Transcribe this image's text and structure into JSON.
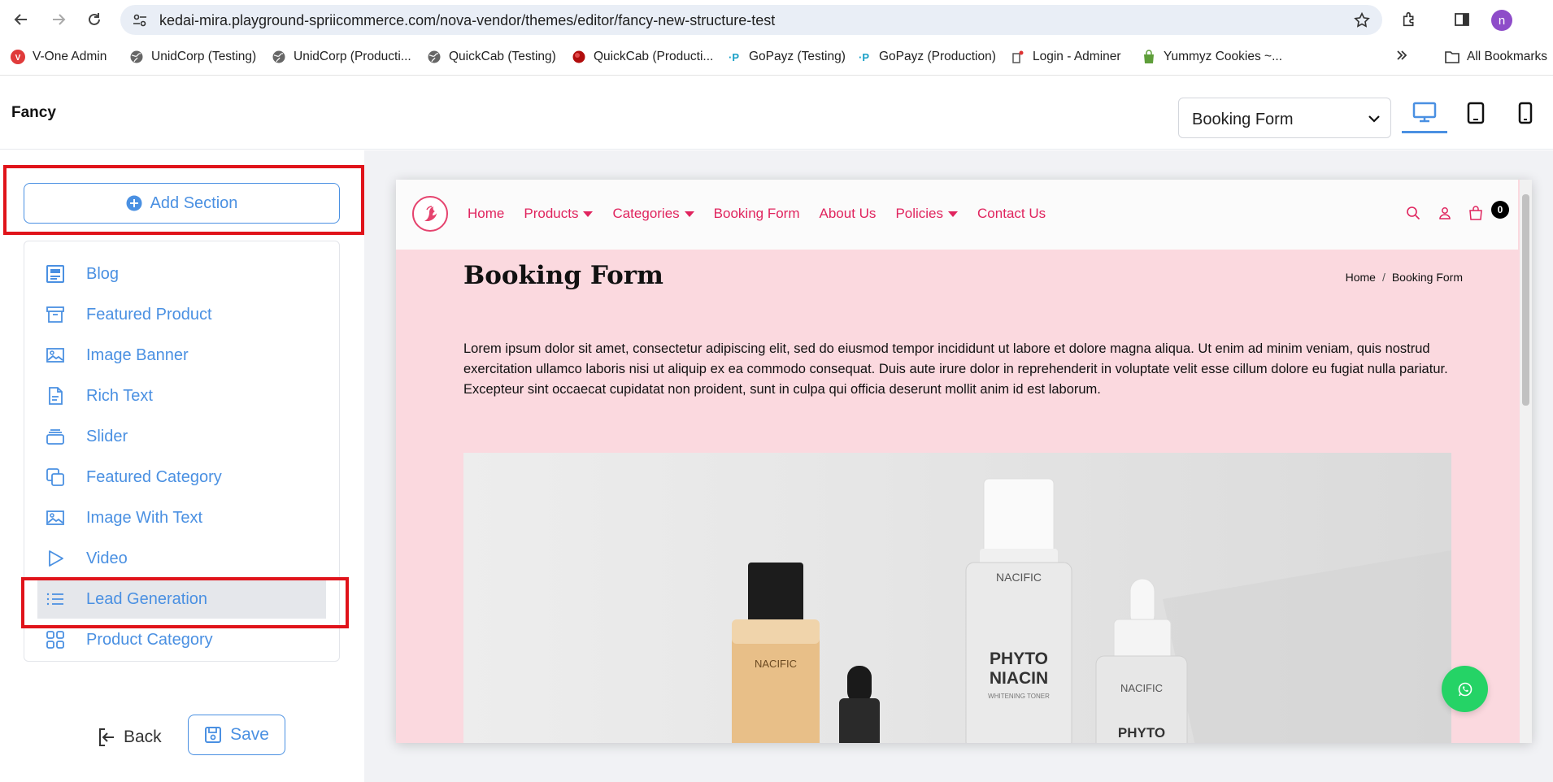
{
  "browser": {
    "url": "kedai-mira.playground-spriicommerce.com/nova-vendor/themes/editor/fancy-new-structure-test",
    "profile_initial": "n",
    "bookmarks": [
      "V-One Admin",
      "UnidCorp (Testing)",
      "UnidCorp (Producti...",
      "QuickCab (Testing)",
      "QuickCab (Producti...",
      "GoPayz (Testing)",
      "GoPayz (Production)",
      "Login - Adminer",
      "Yummyz Cookies ~..."
    ],
    "all_bookmarks": "All Bookmarks"
  },
  "app": {
    "title": "Fancy",
    "page_select_value": "Booking Form"
  },
  "sidebar": {
    "add_section": "Add Section",
    "items": [
      {
        "label": "Blog",
        "icon": "blog-icon"
      },
      {
        "label": "Featured Product",
        "icon": "archive-icon"
      },
      {
        "label": "Image Banner",
        "icon": "image-icon"
      },
      {
        "label": "Rich Text",
        "icon": "document-icon"
      },
      {
        "label": "Slider",
        "icon": "layers-icon"
      },
      {
        "label": "Featured Category",
        "icon": "copy-icon"
      },
      {
        "label": "Image With Text",
        "icon": "image-icon"
      },
      {
        "label": "Video",
        "icon": "play-icon"
      },
      {
        "label": "Lead Generation",
        "icon": "list-icon"
      },
      {
        "label": "Product Category",
        "icon": "grid-icon"
      }
    ],
    "back": "Back",
    "save": "Save"
  },
  "preview": {
    "nav": [
      "Home",
      "Products",
      "Categories",
      "Booking Form",
      "About Us",
      "Policies",
      "Contact Us"
    ],
    "cart_count": "0",
    "heading": "Booking Form",
    "breadcrumb": [
      "Home",
      "Booking Form"
    ],
    "body": "Lorem ipsum dolor sit amet, consectetur adipiscing elit, sed do eiusmod tempor incididunt ut labore et dolore magna aliqua. Ut enim ad minim veniam, quis nostrud exercitation ullamco laboris nisi ut aliquip ex ea commodo consequat. Duis aute irure dolor in reprehenderit in voluptate velit esse cillum dolore eu fugiat nulla pariatur. Excepteur sint occaecat cupidatat non proident, sunt in culpa qui officia deserunt mollit anim id est laborum.",
    "bottle_labels": [
      "NACIFIC",
      "NACIFIC",
      "PHYTO",
      "NIACIN",
      "WHITENING TONER",
      "NACIFIC",
      "PHYTO"
    ]
  },
  "colors": {
    "accent": "#4a90e2",
    "highlight_red": "#e0131a",
    "site_pink": "#e0245e",
    "preview_bg": "#fbd9df",
    "whatsapp": "#25d366"
  }
}
